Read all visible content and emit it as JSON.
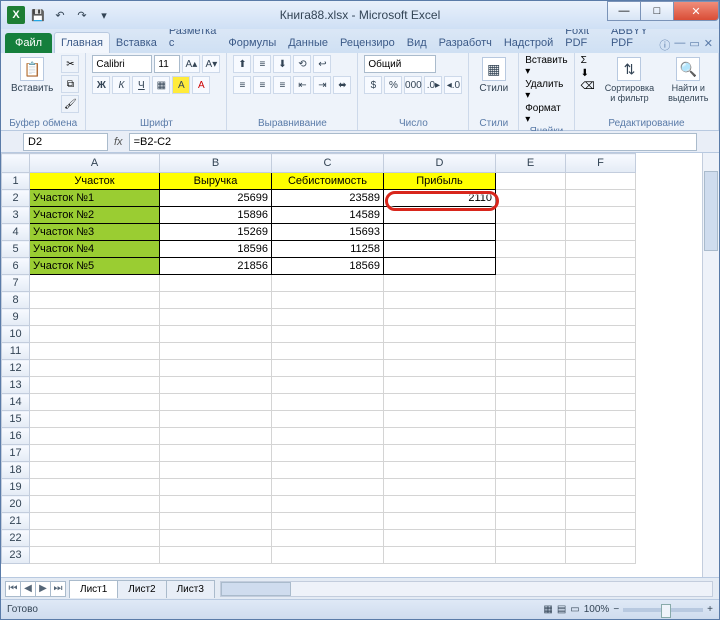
{
  "title": "Книга88.xlsx - Microsoft Excel",
  "qat": {
    "excel": "X",
    "save": "💾",
    "undo": "↶",
    "redo": "↷"
  },
  "tabs": {
    "file": "Файл",
    "items": [
      "Главная",
      "Вставка",
      "Разметка с",
      "Формулы",
      "Данные",
      "Рецензиро",
      "Вид",
      "Разработч",
      "Надстрой",
      "Foxit PDF",
      "ABBYY PDF"
    ],
    "active_index": 0
  },
  "ribbon": {
    "clipboard": {
      "label": "Буфер обмена",
      "paste": "Вставить"
    },
    "font": {
      "label": "Шрифт",
      "name": "Calibri",
      "size": "11"
    },
    "align": {
      "label": "Выравнивание"
    },
    "number": {
      "label": "Число",
      "format": "Общий"
    },
    "styles": {
      "label": "Стили",
      "btn": "Стили"
    },
    "cells": {
      "label": "Ячейки",
      "insert": "Вставить ▾",
      "delete": "Удалить ▾",
      "format": "Формат ▾"
    },
    "editing": {
      "label": "Редактирование",
      "sort": "Сортировка и фильтр",
      "find": "Найти и выделить"
    }
  },
  "nameBox": "D2",
  "formula": "=B2-C2",
  "cols": [
    "A",
    "B",
    "C",
    "D",
    "E",
    "F"
  ],
  "headers": {
    "A": "Участок",
    "B": "Выручка",
    "C": "Себистоимость",
    "D": "Прибыль"
  },
  "rows": [
    {
      "A": "Участок №1",
      "B": "25699",
      "C": "23589",
      "D": "2110"
    },
    {
      "A": "Участок №2",
      "B": "15896",
      "C": "14589",
      "D": ""
    },
    {
      "A": "Участок №3",
      "B": "15269",
      "C": "15693",
      "D": ""
    },
    {
      "A": "Участок №4",
      "B": "18596",
      "C": "11258",
      "D": ""
    },
    {
      "A": "Участок №5",
      "B": "21856",
      "C": "18569",
      "D": ""
    }
  ],
  "sheetTabs": [
    "Лист1",
    "Лист2",
    "Лист3"
  ],
  "status": {
    "ready": "Готово",
    "zoom": "100%"
  },
  "winbtns": {
    "min": "—",
    "max": "□",
    "close": "✕"
  }
}
